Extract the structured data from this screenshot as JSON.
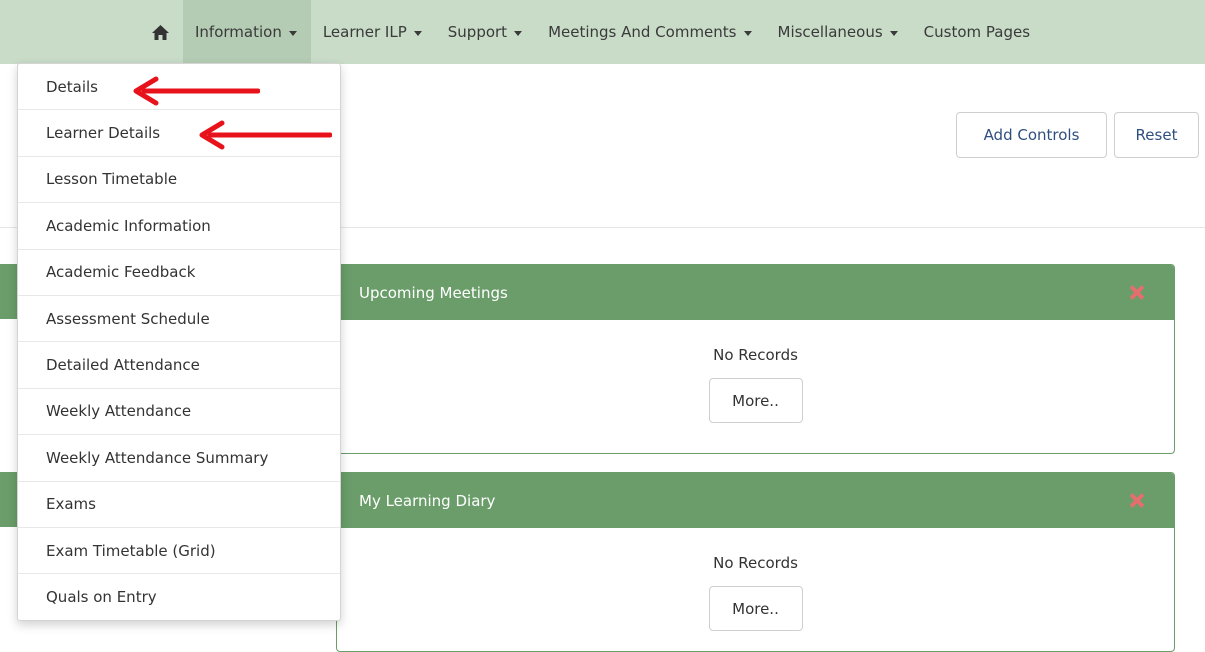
{
  "nav": {
    "home_icon": "home-icon",
    "items": [
      {
        "label": "Information",
        "has_caret": true,
        "active": true
      },
      {
        "label": "Learner ILP",
        "has_caret": true
      },
      {
        "label": "Support",
        "has_caret": true
      },
      {
        "label": "Meetings And Comments",
        "has_caret": true
      },
      {
        "label": "Miscellaneous",
        "has_caret": true
      },
      {
        "label": "Custom Pages",
        "has_caret": false
      }
    ]
  },
  "toolbar": {
    "add_controls_label": "Add Controls",
    "reset_label": "Reset"
  },
  "dropdown": {
    "items": [
      "Details",
      "Learner Details",
      "Lesson Timetable",
      "Academic Information",
      "Academic Feedback",
      "Assessment Schedule",
      "Detailed Attendance",
      "Weekly Attendance",
      "Weekly Attendance Summary",
      "Exams",
      "Exam Timetable (Grid)",
      "Quals on Entry"
    ]
  },
  "panels": [
    {
      "title": "Upcoming Meetings",
      "body_text": "No Records",
      "button_label": "More.."
    },
    {
      "title": "My Learning Diary",
      "body_text": "No Records",
      "button_label": "More.."
    }
  ],
  "colors": {
    "nav_bg": "#c8dcc8",
    "nav_active_bg": "#b4ccb4",
    "panel_header": "#6a9d6a",
    "close_icon": "#e36f6f",
    "annotation_arrow": "#e8121a"
  }
}
